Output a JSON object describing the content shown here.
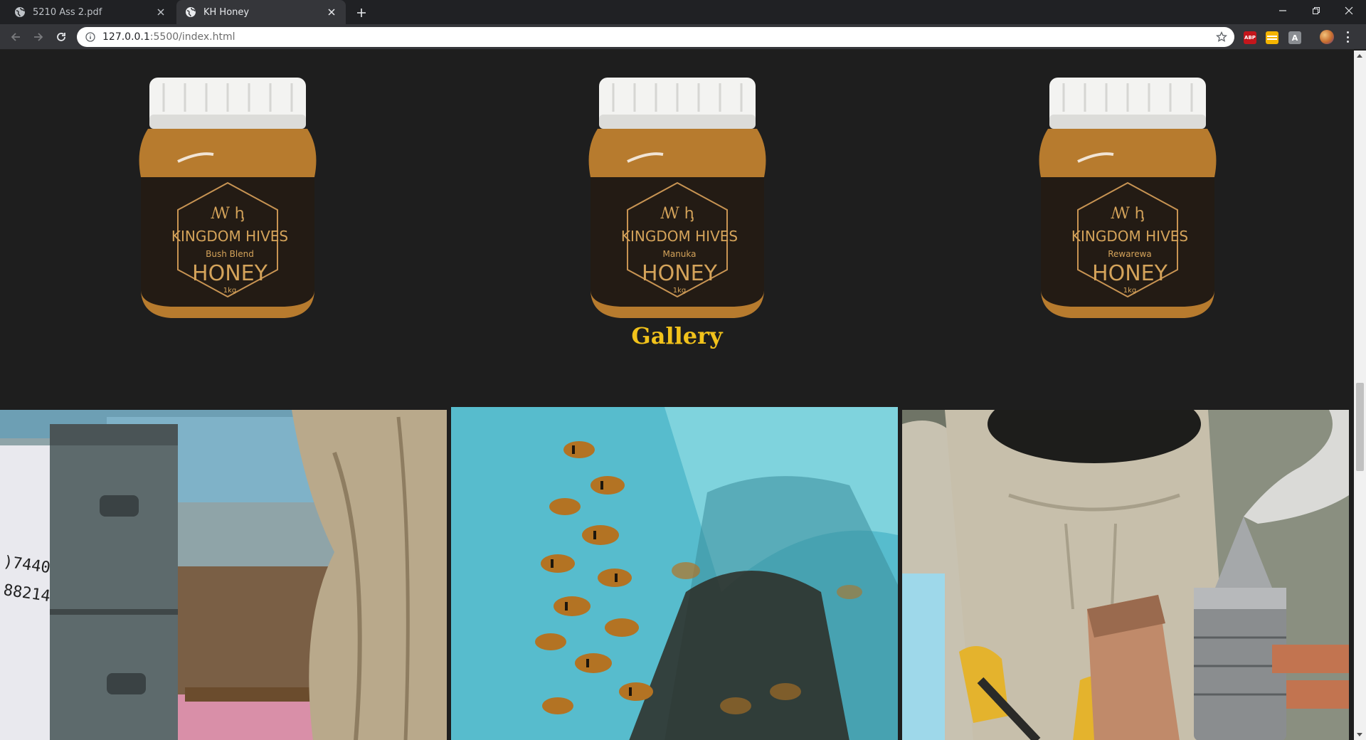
{
  "browser": {
    "tabs": [
      {
        "title": "5210 Ass 2.pdf",
        "active": false
      },
      {
        "title": "KH Honey",
        "active": true
      }
    ],
    "url_host": "127.0.0.1",
    "url_path": ":5500/index.html",
    "extensions": [
      "ABP",
      "notes",
      "A"
    ]
  },
  "products": [
    {
      "brand": "KINGDOM HIVES",
      "variety": "Bush Blend",
      "product": "HONEY",
      "size": "1kg"
    },
    {
      "brand": "KINGDOM HIVES",
      "variety": "Manuka",
      "product": "HONEY",
      "size": "1kg"
    },
    {
      "brand": "KINGDOM HIVES",
      "variety": "Rewarewa",
      "product": "HONEY",
      "size": "1kg"
    }
  ],
  "gallery": {
    "title": "Gallery",
    "images": [
      {
        "name": "beehive-boxes"
      },
      {
        "name": "bees-on-hive"
      },
      {
        "name": "beekeeper-smoker"
      }
    ]
  },
  "colors": {
    "accent_gold": "#f1c21b",
    "page_background": "#1e1e1e",
    "label_gold": "#d4a35a"
  }
}
